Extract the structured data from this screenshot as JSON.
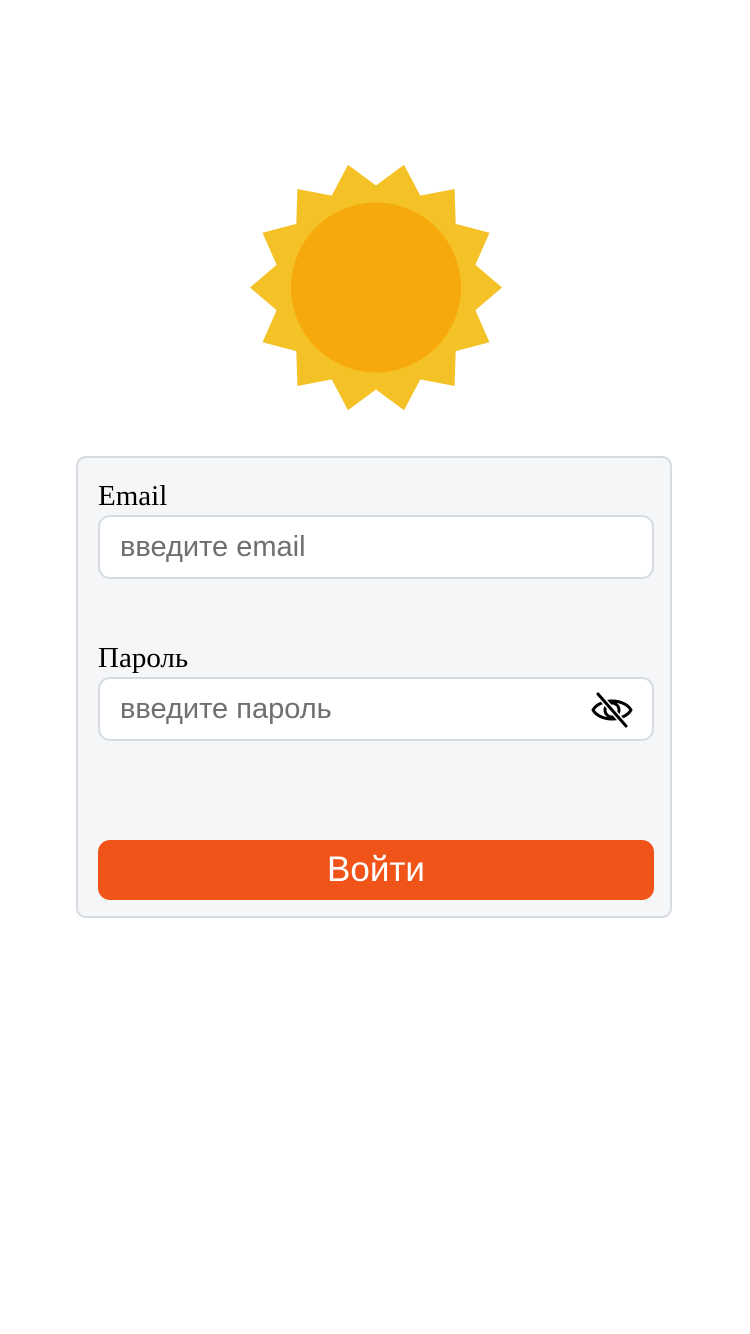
{
  "logo": {
    "icon": "sun-icon",
    "ray_color": "#f4c226",
    "disc_color": "#f6a90a"
  },
  "form": {
    "email": {
      "label": "Email",
      "placeholder": "введите email",
      "value": ""
    },
    "password": {
      "label": "Пароль",
      "placeholder": "введите пароль",
      "value": "",
      "toggle_icon": "eye-off-icon"
    },
    "submit_label": "Войти"
  },
  "colors": {
    "accent": "#f05418",
    "card_background": "#f5f6f8",
    "border": "#d6dbe1"
  }
}
